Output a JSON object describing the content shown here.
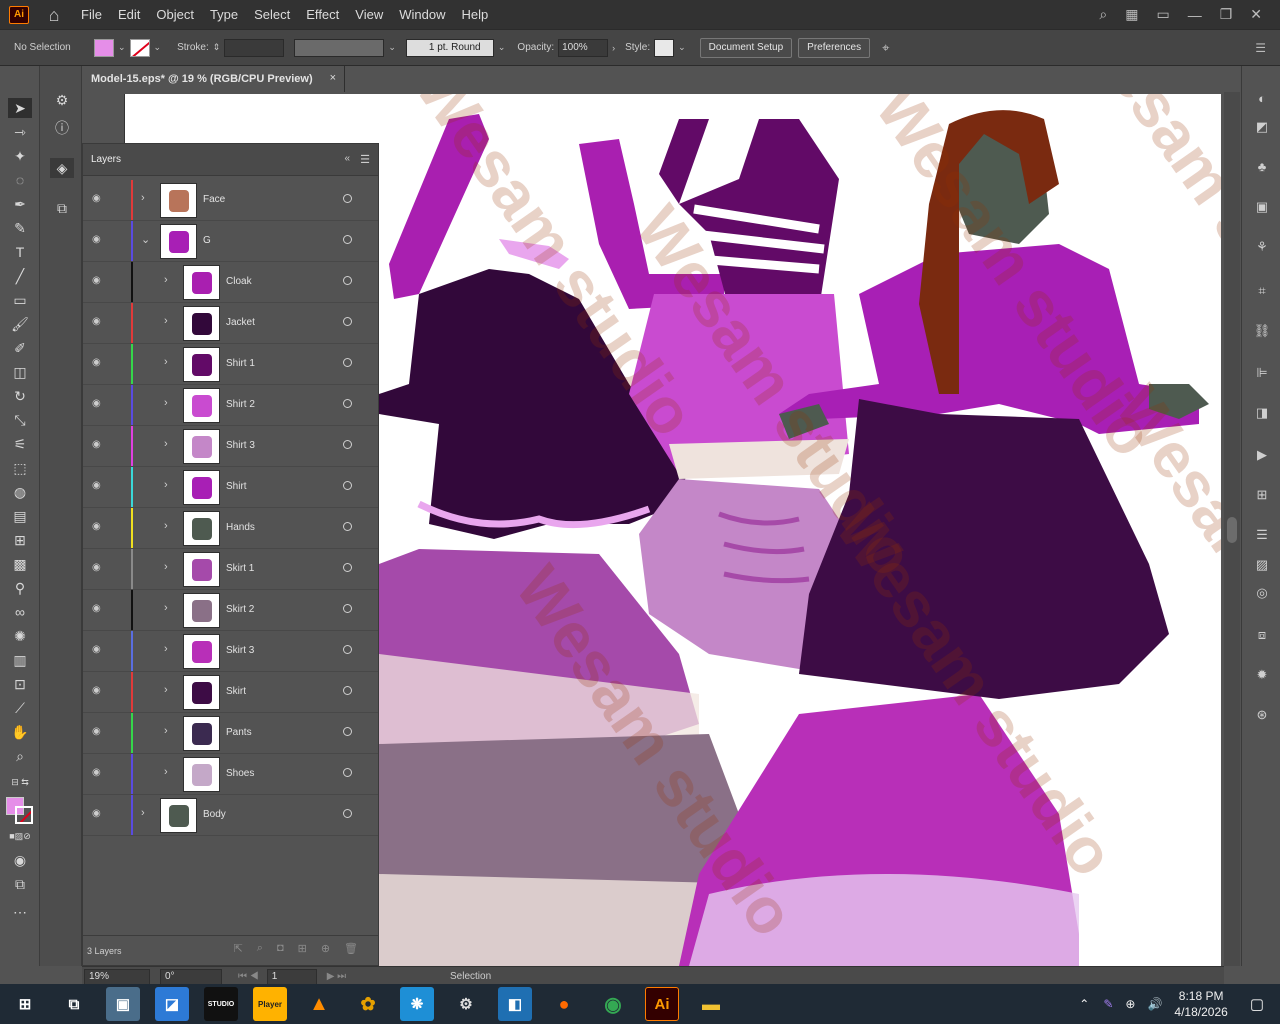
{
  "app": {
    "logo": "Ai"
  },
  "menu": [
    "File",
    "Edit",
    "Object",
    "Type",
    "Select",
    "Effect",
    "View",
    "Window",
    "Help"
  ],
  "control": {
    "selection_label": "No Selection",
    "stroke_label": "Stroke:",
    "brush_value": "1 pt. Round",
    "opacity_label": "Opacity:",
    "opacity_value": "100%",
    "style_label": "Style:",
    "document_setup": "Document Setup",
    "preferences": "Preferences"
  },
  "document": {
    "tab_title": "Model-15.eps* @ 19 % (RGB/CPU Preview)",
    "close": "×"
  },
  "layers_panel": {
    "title": "Layers",
    "count": "3 Layers",
    "layers": [
      {
        "name": "Face",
        "color": "#e03a3a",
        "indent": 0,
        "expanded": false
      },
      {
        "name": "G",
        "color": "#5a4be0",
        "indent": 0,
        "expanded": true
      },
      {
        "name": "Cloak",
        "color": "#111111",
        "indent": 1,
        "expanded": false
      },
      {
        "name": "Jacket",
        "color": "#e03a3a",
        "indent": 1,
        "expanded": false
      },
      {
        "name": "Shirt 1",
        "color": "#35d64a",
        "indent": 1,
        "expanded": false
      },
      {
        "name": "Shirt 2",
        "color": "#5a4be0",
        "indent": 1,
        "expanded": false
      },
      {
        "name": "Shirt 3",
        "color": "#e040e0",
        "indent": 1,
        "expanded": false
      },
      {
        "name": "Shirt",
        "color": "#3ad8d8",
        "indent": 1,
        "expanded": false
      },
      {
        "name": "Hands",
        "color": "#f0e020",
        "indent": 1,
        "expanded": false
      },
      {
        "name": "Skirt 1",
        "color": "#8a8a8a",
        "indent": 1,
        "expanded": false
      },
      {
        "name": "Skirt 2",
        "color": "#111111",
        "indent": 1,
        "expanded": false
      },
      {
        "name": "Skirt 3",
        "color": "#5a6ee0",
        "indent": 1,
        "expanded": false
      },
      {
        "name": "Skirt",
        "color": "#e03a3a",
        "indent": 1,
        "expanded": false
      },
      {
        "name": "Pants",
        "color": "#35d64a",
        "indent": 1,
        "expanded": false
      },
      {
        "name": "Shoes",
        "color": "#5a4be0",
        "indent": 1,
        "expanded": false
      },
      {
        "name": "Body",
        "color": "#5a4be0",
        "indent": 0,
        "expanded": false
      }
    ]
  },
  "status": {
    "zoom": "19%",
    "rotation": "0°",
    "artboard": "1",
    "tool": "Selection"
  },
  "watermark": "Wesam studio",
  "taskbar": {
    "time": "8:18 PM",
    "date": "4/18/2026",
    "player_label": "Player",
    "studio_label": "STUDIO"
  }
}
